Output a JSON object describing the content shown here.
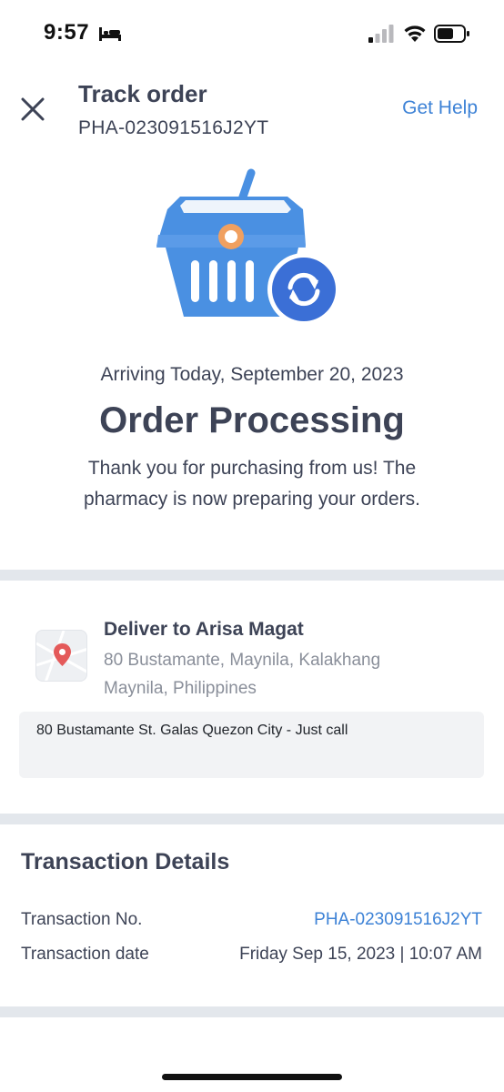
{
  "status_bar": {
    "time": "9:57",
    "icons": [
      "bed-icon",
      "signal-icon",
      "wifi-icon",
      "battery-icon"
    ]
  },
  "header": {
    "title": "Track order",
    "order_id": "PHA-023091516J2YT",
    "help_label": "Get Help"
  },
  "order_status": {
    "arrival": "Arriving Today, September 20, 2023",
    "status": "Order Processing",
    "message": "Thank you for purchasing from us! The pharmacy is now preparing your orders."
  },
  "delivery": {
    "title": "Deliver to Arisa Magat",
    "address": "80 Bustamante, Maynila, Kalakhang Maynila, Philippines",
    "note": "80 Bustamante St. Galas Quezon City - Just call"
  },
  "transaction": {
    "title": "Transaction Details",
    "rows": [
      {
        "label": "Transaction No.",
        "value": "PHA-023091516J2YT"
      },
      {
        "label": "Transaction date",
        "value": "Friday Sep 15, 2023 | 10:07 AM"
      }
    ]
  },
  "colors": {
    "accent": "#3d82d6",
    "text": "#3d4356",
    "muted": "#8a8f9a",
    "divider": "#e3e7ec",
    "basket_blue": "#4a90e2",
    "basket_orange": "#f0a060"
  }
}
